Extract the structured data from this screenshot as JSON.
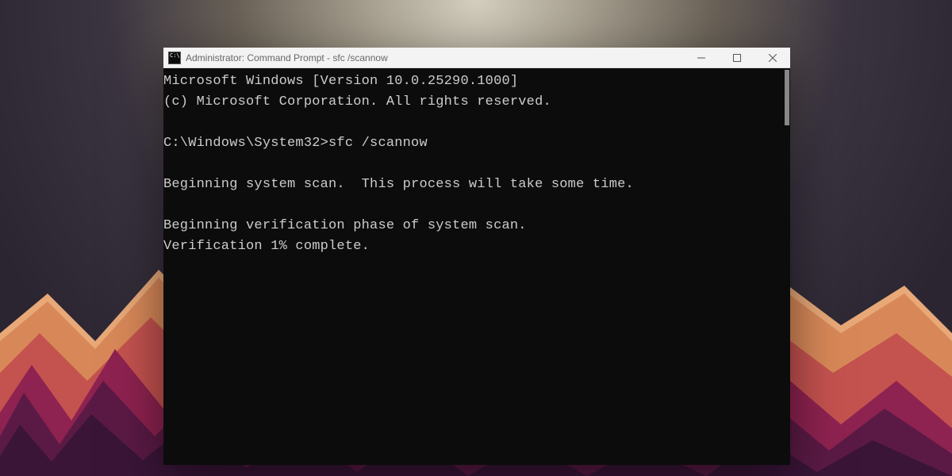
{
  "window": {
    "title": "Administrator: Command Prompt - sfc  /scannow"
  },
  "console": {
    "line1": "Microsoft Windows [Version 10.0.25290.1000]",
    "line2": "(c) Microsoft Corporation. All rights reserved.",
    "blank1": "",
    "prompt_line": "C:\\Windows\\System32>sfc /scannow",
    "blank2": "",
    "scan1": "Beginning system scan.  This process will take some time.",
    "blank3": "",
    "scan2": "Beginning verification phase of system scan.",
    "scan3": "Verification 1% complete."
  }
}
